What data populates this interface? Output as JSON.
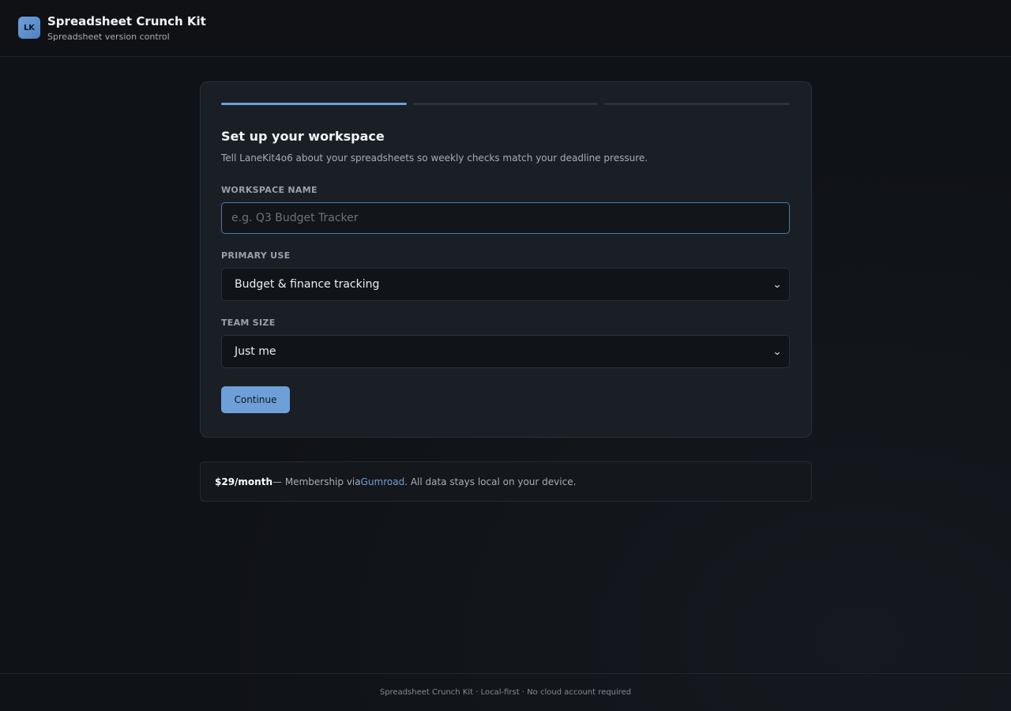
{
  "header": {
    "logo_text": "LK",
    "title": "Spreadsheet Crunch Kit",
    "subtitle": "Spreadsheet version control"
  },
  "wizard": {
    "progress_steps": 3,
    "current_step": 1,
    "title": "Set up your workspace",
    "description": "Tell LaneKit4o6 about your spreadsheets so weekly checks match your deadline pressure.",
    "workspace_name": {
      "label": "Workspace name",
      "value": "",
      "placeholder": "e.g. Q3 Budget Tracker"
    },
    "primary_use": {
      "label": "Primary use",
      "selected": "Budget & finance tracking"
    },
    "team_size": {
      "label": "Team size",
      "selected": "Just me"
    },
    "continue_label": "Continue"
  },
  "pricing": {
    "price": "$29/month",
    "text_before_link": " — Membership via ",
    "link_text": "Gumroad",
    "text_after_link": ". All data stays local on your device."
  },
  "footer": {
    "text": "Spreadsheet Crunch Kit · Local-first · No cloud account required"
  },
  "colors": {
    "accent": "#6f9fd8",
    "background": "#0f1216",
    "card": "#1a1f26"
  }
}
